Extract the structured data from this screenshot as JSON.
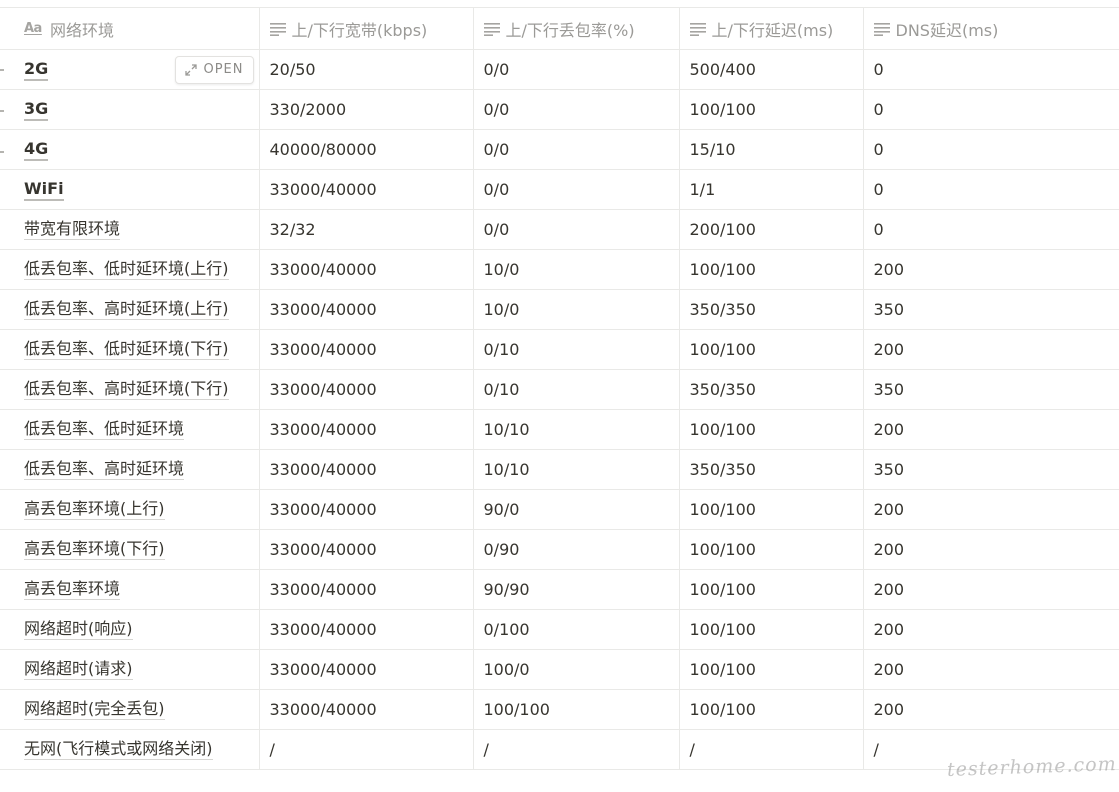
{
  "columns": [
    {
      "label": "网络环境",
      "icon": "text-type-icon"
    },
    {
      "label": "上/下行宽带(kbps)",
      "icon": "text-lines-icon"
    },
    {
      "label": "上/下行丢包率(%)",
      "icon": "text-lines-icon"
    },
    {
      "label": "上/下行延迟(ms)",
      "icon": "text-lines-icon"
    },
    {
      "label": "DNS延迟(ms)",
      "icon": "text-lines-icon"
    }
  ],
  "header_icon_text": "Aa",
  "open_button_label": "OPEN",
  "rows": [
    [
      "2G",
      "20/50",
      "0/0",
      "500/400",
      "0"
    ],
    [
      "3G",
      "330/2000",
      "0/0",
      "100/100",
      "0"
    ],
    [
      "4G",
      "40000/80000",
      "0/0",
      "15/10",
      "0"
    ],
    [
      "WiFi",
      "33000/40000",
      "0/0",
      "1/1",
      "0"
    ],
    [
      "带宽有限环境",
      "32/32",
      "0/0",
      "200/100",
      "0"
    ],
    [
      "低丢包率、低时延环境(上行)",
      "33000/40000",
      "10/0",
      "100/100",
      "200"
    ],
    [
      "低丢包率、高时延环境(上行)",
      "33000/40000",
      "10/0",
      "350/350",
      "350"
    ],
    [
      "低丢包率、低时延环境(下行)",
      "33000/40000",
      "0/10",
      "100/100",
      "200"
    ],
    [
      "低丢包率、高时延环境(下行)",
      "33000/40000",
      "0/10",
      "350/350",
      "350"
    ],
    [
      "低丢包率、低时延环境",
      "33000/40000",
      "10/10",
      "100/100",
      "200"
    ],
    [
      "低丢包率、高时延环境",
      "33000/40000",
      "10/10",
      "350/350",
      "350"
    ],
    [
      "高丢包率环境(上行)",
      "33000/40000",
      "90/0",
      "100/100",
      "200"
    ],
    [
      "高丢包率环境(下行)",
      "33000/40000",
      "0/90",
      "100/100",
      "200"
    ],
    [
      "高丢包率环境",
      "33000/40000",
      "90/90",
      "100/100",
      "200"
    ],
    [
      "网络超时(响应)",
      "33000/40000",
      "0/100",
      "100/100",
      "200"
    ],
    [
      "网络超时(请求)",
      "33000/40000",
      "100/0",
      "100/100",
      "200"
    ],
    [
      "网络超时(完全丢包)",
      "33000/40000",
      "100/100",
      "100/100",
      "200"
    ],
    [
      "无网(飞行模式或网络关闭)",
      "/",
      "/",
      "/",
      "/"
    ]
  ],
  "watermark": "testerhome.com",
  "colors": {
    "text": "#37352f",
    "header_text": "#9b9a97",
    "border": "#e9e9e7"
  }
}
